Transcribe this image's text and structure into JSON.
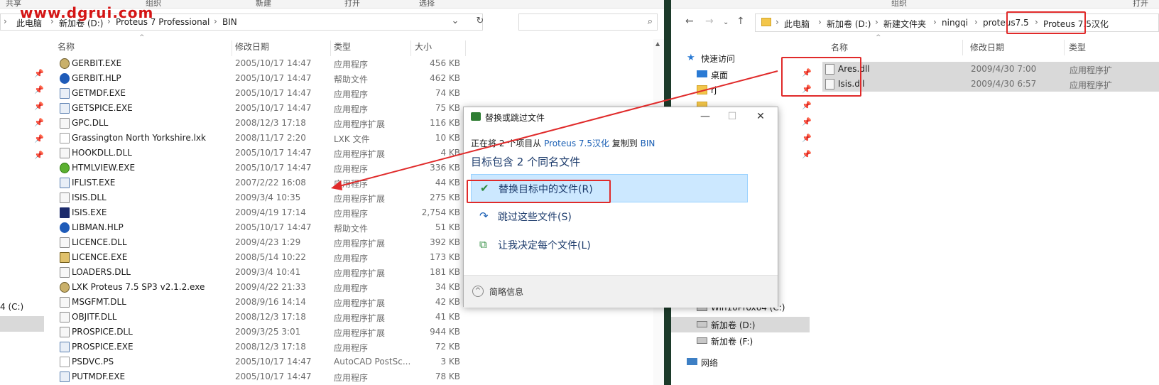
{
  "watermark": "www.dgrui.com",
  "left": {
    "ribbon": [
      "共享",
      "组织",
      "新建",
      "打开",
      "选择"
    ],
    "breadcrumb": [
      "此电脑",
      "新加卷 (D:)",
      "Proteus 7 Professional",
      "BIN"
    ],
    "columns": {
      "name": "名称",
      "date": "修改日期",
      "type": "类型",
      "size": "大小"
    },
    "drive_c": "4 (C:)",
    "files": [
      {
        "icon": "gerbit-icon",
        "name": "GERBIT.EXE",
        "date": "2005/10/17 14:47",
        "type": "应用程序",
        "size": "456 KB"
      },
      {
        "icon": "help-icon",
        "name": "GERBIT.HLP",
        "date": "2005/10/17 14:47",
        "type": "帮助文件",
        "size": "462 KB"
      },
      {
        "icon": "window-icon",
        "name": "GETMDF.EXE",
        "date": "2005/10/17 14:47",
        "type": "应用程序",
        "size": "74 KB"
      },
      {
        "icon": "window-icon",
        "name": "GETSPICE.EXE",
        "date": "2005/10/17 14:47",
        "type": "应用程序",
        "size": "75 KB"
      },
      {
        "icon": "dll-icon",
        "name": "GPC.DLL",
        "date": "2008/12/3 17:18",
        "type": "应用程序扩展",
        "size": "116 KB"
      },
      {
        "icon": "document-icon",
        "name": "Grassington North Yorkshire.lxk",
        "date": "2008/11/17 2:20",
        "type": "LXK 文件",
        "size": "10 KB"
      },
      {
        "icon": "dll-icon",
        "name": "HOOKDLL.DLL",
        "date": "2005/10/17 14:47",
        "type": "应用程序扩展",
        "size": "4 KB"
      },
      {
        "icon": "globe-icon",
        "name": "HTMLVIEW.EXE",
        "date": "2005/10/17 14:47",
        "type": "应用程序",
        "size": "336 KB"
      },
      {
        "icon": "window-icon",
        "name": "IFLIST.EXE",
        "date": "2007/2/22 16:08",
        "type": "应用程序",
        "size": "44 KB"
      },
      {
        "icon": "dll-icon",
        "name": "ISIS.DLL",
        "date": "2009/3/4 10:35",
        "type": "应用程序扩展",
        "size": "275 KB"
      },
      {
        "icon": "isis-icon",
        "name": "ISIS.EXE",
        "date": "2009/4/19 17:14",
        "type": "应用程序",
        "size": "2,754 KB"
      },
      {
        "icon": "help-icon",
        "name": "LIBMAN.HLP",
        "date": "2005/10/17 14:47",
        "type": "帮助文件",
        "size": "51 KB"
      },
      {
        "icon": "dll-icon",
        "name": "LICENCE.DLL",
        "date": "2009/4/23 1:29",
        "type": "应用程序扩展",
        "size": "392 KB"
      },
      {
        "icon": "lock-icon",
        "name": "LICENCE.EXE",
        "date": "2008/5/14 10:22",
        "type": "应用程序",
        "size": "173 KB"
      },
      {
        "icon": "dll-icon",
        "name": "LOADERS.DLL",
        "date": "2009/3/4 10:41",
        "type": "应用程序扩展",
        "size": "181 KB"
      },
      {
        "icon": "installer-icon",
        "name": "LXK Proteus 7.5 SP3 v2.1.2.exe",
        "date": "2009/4/22 21:33",
        "type": "应用程序",
        "size": "34 KB"
      },
      {
        "icon": "dll-icon",
        "name": "MSGFMT.DLL",
        "date": "2008/9/16 14:14",
        "type": "应用程序扩展",
        "size": "42 KB"
      },
      {
        "icon": "dll-icon",
        "name": "OBJITF.DLL",
        "date": "2008/12/3 17:18",
        "type": "应用程序扩展",
        "size": "41 KB"
      },
      {
        "icon": "dll-icon",
        "name": "PROSPICE.DLL",
        "date": "2009/3/25 3:01",
        "type": "应用程序扩展",
        "size": "944 KB"
      },
      {
        "icon": "window-icon",
        "name": "PROSPICE.EXE",
        "date": "2008/12/3 17:18",
        "type": "应用程序",
        "size": "72 KB"
      },
      {
        "icon": "document-icon",
        "name": "PSDVC.PS",
        "date": "2005/10/17 14:47",
        "type": "AutoCAD PostSc...",
        "size": "3 KB"
      },
      {
        "icon": "window-icon",
        "name": "PUTMDF.EXE",
        "date": "2005/10/17 14:47",
        "type": "应用程序",
        "size": "78 KB"
      }
    ]
  },
  "right": {
    "ribbon": [
      "组织",
      "打开"
    ],
    "breadcrumb": [
      "此电脑",
      "新加卷 (D:)",
      "新建文件夹",
      "ningqi",
      "proteus7.5",
      "Proteus 7.5汉化"
    ],
    "columns": {
      "name": "名称",
      "date": "修改日期",
      "type": "类型"
    },
    "nav": {
      "quick_access": "快速访问",
      "desktop": "桌面",
      "rj": "rj",
      "win10": "Win10Prox64 (C:)",
      "drive_d": "新加卷 (D:)",
      "drive_f": "新加卷 (F:)",
      "network": "网络"
    },
    "files": [
      {
        "name": "Ares.dll",
        "date": "2009/4/30 7:00",
        "type": "应用程序扩"
      },
      {
        "name": "Isis.dll",
        "date": "2009/4/30 6:57",
        "type": "应用程序扩"
      }
    ]
  },
  "dialog": {
    "title": "替换或跳过文件",
    "line_prefix": "正在将 2 个项目从 ",
    "source": "Proteus 7.5汉化",
    "line_mid": " 复制到 ",
    "dest": "BIN",
    "heading": "目标包含 2 个同名文件",
    "options": [
      {
        "icon": "checkmark-icon",
        "glyph": "✔",
        "label": "替换目标中的文件(R)"
      },
      {
        "icon": "skip-icon",
        "glyph": "↷",
        "label": "跳过这些文件(S)"
      },
      {
        "icon": "decide-icon",
        "glyph": "⧉",
        "label": "让我决定每个文件(L)"
      }
    ],
    "footer": "简略信息"
  },
  "colors": {
    "annotation": "#e02a2a",
    "highlight": "#cce8ff",
    "link": "#1a5fb4"
  }
}
